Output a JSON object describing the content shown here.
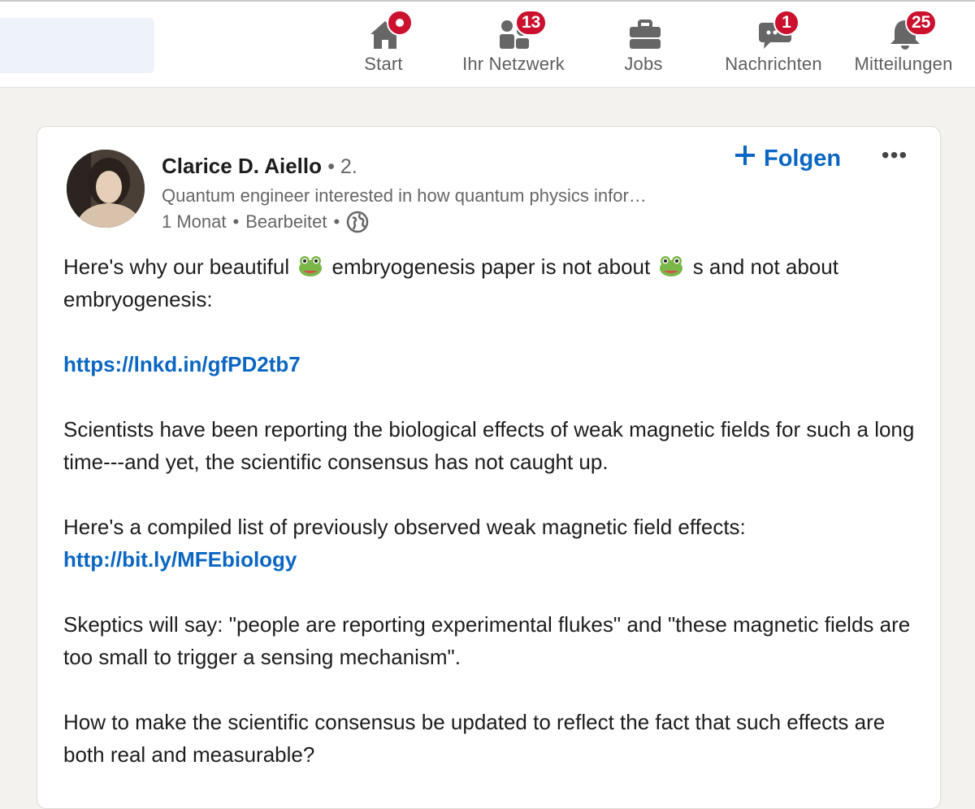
{
  "nav": {
    "items": [
      {
        "label": "Start",
        "icon": "home-icon",
        "badge": ""
      },
      {
        "label": "Ihr Netzwerk",
        "icon": "network-icon",
        "badge": "13"
      },
      {
        "label": "Jobs",
        "icon": "briefcase-icon",
        "badge": ""
      },
      {
        "label": "Nachrichten",
        "icon": "messaging-icon",
        "badge": "1"
      },
      {
        "label": "Mitteilungen",
        "icon": "bell-icon",
        "badge": "25"
      }
    ]
  },
  "post": {
    "author": {
      "name": "Clarice D. Aiello",
      "degree": "• 2.",
      "headline": "Quantum engineer interested in how quantum physics infor…",
      "time": "1 Monat",
      "edited": "Bearbeitet"
    },
    "follow_label": "Folgen",
    "more_label": "•••",
    "body": {
      "p1_a": "Here's why our beautiful ",
      "p1_b": " embryogenesis paper is not about ",
      "p1_c": " s and not about embryogenesis:",
      "link1": "https://lnkd.in/gfPD2tb7",
      "p3": "Scientists have been reporting the biological effects of weak magnetic fields for such a long time---and yet, the scientific consensus has not caught up.",
      "p4_a": "Here's a compiled list of previously observed weak magnetic field effects: ",
      "link2": "http://bit.ly/MFEbiology",
      "p5": "Skeptics will say: \"people are reporting experimental flukes\" and \"these magnetic fields are too small to trigger a sensing mechanism\".",
      "p6": "How to make the scientific consensus be updated to reflect the fact that such effects are both real and measurable?"
    }
  },
  "colors": {
    "accent": "#0a66c2",
    "badge": "#cb112d",
    "background": "#f4f2ee"
  }
}
